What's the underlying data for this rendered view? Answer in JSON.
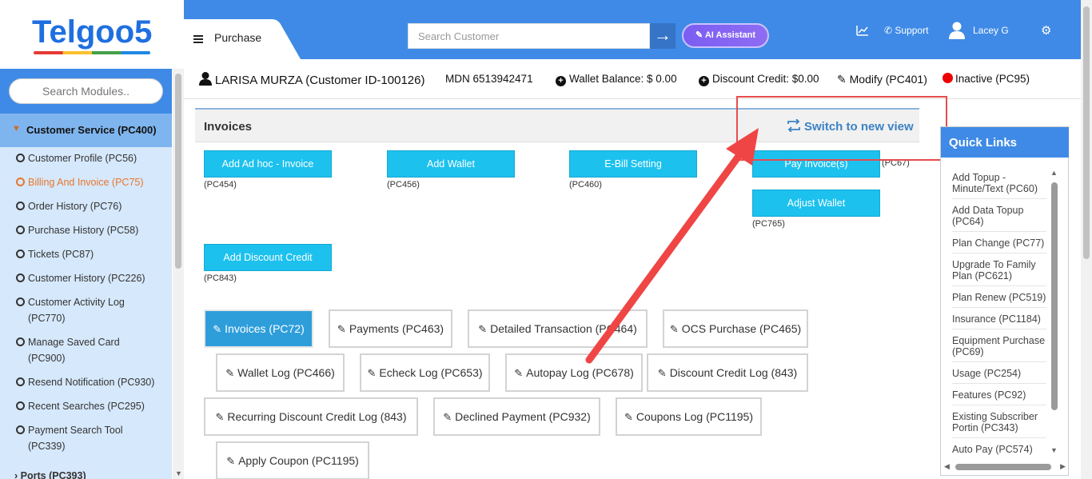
{
  "brand": {
    "logo": "Telgoo5"
  },
  "header": {
    "page_tab": "Purchase",
    "search_placeholder": "Search Customer",
    "ai_button": "AI Assistant",
    "support": "Support",
    "user": "Lacey G"
  },
  "sidebar": {
    "search_placeholder": "Search Modules..",
    "section": "Customer Service (PC400)",
    "items": [
      {
        "label": "Customer Profile (PC56)"
      },
      {
        "label": "Billing And Invoice (PC75)",
        "active": true
      },
      {
        "label": "Order History (PC76)"
      },
      {
        "label": "Purchase History (PC58)"
      },
      {
        "label": "Tickets (PC87)"
      },
      {
        "label": "Customer History (PC226)"
      },
      {
        "label": "Customer Activity Log",
        "label2": "(PC770)"
      },
      {
        "label": "Manage Saved Card",
        "label2": "(PC900)"
      },
      {
        "label": "Resend Notification (PC930)"
      },
      {
        "label": "Recent Searches (PC295)"
      },
      {
        "label": "Payment Search Tool",
        "label2": "(PC339)"
      }
    ],
    "next_section": "Ports (PC393)"
  },
  "customer": {
    "name": "LARISA MURZA (Customer ID-100126)",
    "mdn": "MDN 6513942471",
    "wallet": "Wallet Balance: $ 0.00",
    "discount": "Discount Credit: $0.00",
    "modify": "Modify (PC401)",
    "status": "Inactive (PC95)"
  },
  "invoices": {
    "title": "Invoices",
    "switch_view": "Switch to new view",
    "actions": [
      {
        "label": "Add Ad hoc - Invoice",
        "code": "(PC454)"
      },
      {
        "label": "Add Wallet",
        "code": "(PC456)"
      },
      {
        "label": "E-Bill Setting",
        "code": "(PC460)"
      },
      {
        "label": "Pay Invoice(s)",
        "code": "(PC67)"
      },
      {
        "label": "Adjust Wallet",
        "code": "(PC765)"
      },
      {
        "label": "Add Discount Credit",
        "code": "(PC843)"
      }
    ],
    "tabs": [
      {
        "label": "Invoices (PC72)",
        "selected": true
      },
      {
        "label": "Payments (PC463)"
      },
      {
        "label": "Detailed Transaction (PC464)"
      },
      {
        "label": "OCS Purchase (PC465)"
      },
      {
        "label": "Wallet Log (PC466)"
      },
      {
        "label": "Echeck Log (PC653)"
      },
      {
        "label": "Autopay Log (PC678)"
      },
      {
        "label": "Discount Credit Log (843)"
      },
      {
        "label": "Recurring Discount Credit Log (843)"
      },
      {
        "label": "Declined Payment (PC932)"
      },
      {
        "label": "Coupons Log (PC1195)"
      },
      {
        "label": "Apply Coupon (PC1195)"
      }
    ]
  },
  "quick_links": {
    "title": "Quick Links",
    "items": [
      "Add Topup - Minute/Text (PC60)",
      "Add Data Topup (PC64)",
      "Plan Change (PC77)",
      "Upgrade To Family Plan (PC621)",
      "Plan Renew (PC519)",
      "Insurance (PC1184)",
      "Equipment Purchase (PC69)",
      "Usage (PC254)",
      "Features (PC92)",
      "Existing Subscriber Portin (PC343)",
      "Auto Pay (PC574)"
    ]
  },
  "colors": {
    "header": "#3f8ae6",
    "action": "#1cc1ee",
    "tab_selected": "#2e9edb",
    "annotation": "#e74c4c",
    "active_item": "#e8762c"
  }
}
